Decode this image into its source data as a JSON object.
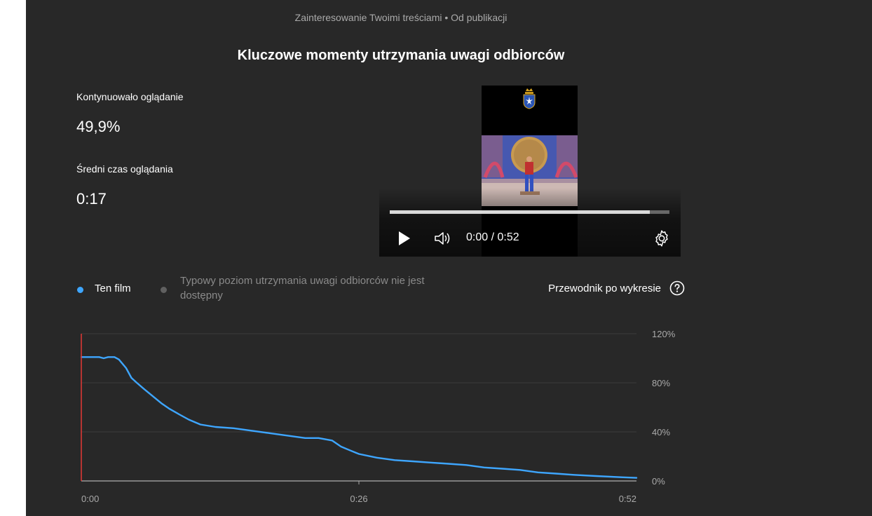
{
  "header": {
    "subtitle": "Zainteresowanie Twoimi treściami • Od publikacji",
    "title": "Kluczowe momenty utrzymania uwagi odbiorców"
  },
  "stats": {
    "continued_label": "Kontynuowało oglądanie",
    "continued_value": "49,9%",
    "avg_label": "Średni czas oglądania",
    "avg_value": "0:17"
  },
  "player": {
    "time": "0:00 / 0:52",
    "buffered_fraction": 0.93,
    "icons": [
      "play-icon",
      "volume-icon",
      "settings-icon"
    ]
  },
  "legend": {
    "this_video": "Ten film",
    "typical_line1": "Typowy poziom utrzymania uwagi odbiorców nie jest",
    "typical_line2": "dostępny",
    "guide": "Przewodnik po wykresie",
    "colors": {
      "this_video": "#3ea6ff",
      "typical": "#606060"
    }
  },
  "chart_data": {
    "type": "line",
    "x_ticks": [
      "0:00",
      "0:26",
      "0:52"
    ],
    "y_ticks": [
      "120%",
      "80%",
      "40%",
      "0%"
    ],
    "ylim": [
      0,
      120
    ],
    "xlim_seconds": [
      0,
      52
    ],
    "series": [
      {
        "name": "Ten film",
        "color": "#3ea6ff",
        "points": [
          [
            0,
            101
          ],
          [
            2,
            101
          ],
          [
            2.5,
            100
          ],
          [
            3,
            101
          ],
          [
            3.7,
            101
          ],
          [
            4.2,
            99
          ],
          [
            5,
            92
          ],
          [
            5.6,
            84
          ],
          [
            6.2,
            80
          ],
          [
            7,
            75
          ],
          [
            8,
            69
          ],
          [
            9,
            63
          ],
          [
            9.8,
            59
          ],
          [
            11,
            54
          ],
          [
            12,
            50
          ],
          [
            13.3,
            46
          ],
          [
            15,
            44
          ],
          [
            17,
            43
          ],
          [
            19,
            41
          ],
          [
            21,
            39
          ],
          [
            23,
            37
          ],
          [
            25,
            35
          ],
          [
            26.5,
            35
          ],
          [
            28,
            33
          ],
          [
            29,
            28
          ],
          [
            30,
            25
          ],
          [
            31,
            22
          ],
          [
            33,
            19
          ],
          [
            35,
            17
          ],
          [
            37,
            16
          ],
          [
            39,
            15
          ],
          [
            41,
            14
          ],
          [
            43,
            13
          ],
          [
            45,
            11
          ],
          [
            47,
            10
          ],
          [
            49,
            9
          ],
          [
            51,
            7
          ],
          [
            53,
            6
          ],
          [
            55,
            5
          ],
          [
            57.5,
            4
          ],
          [
            60.5,
            3
          ],
          [
            62,
            2.5
          ]
        ]
      }
    ],
    "playhead_seconds": 0,
    "grid": true
  }
}
